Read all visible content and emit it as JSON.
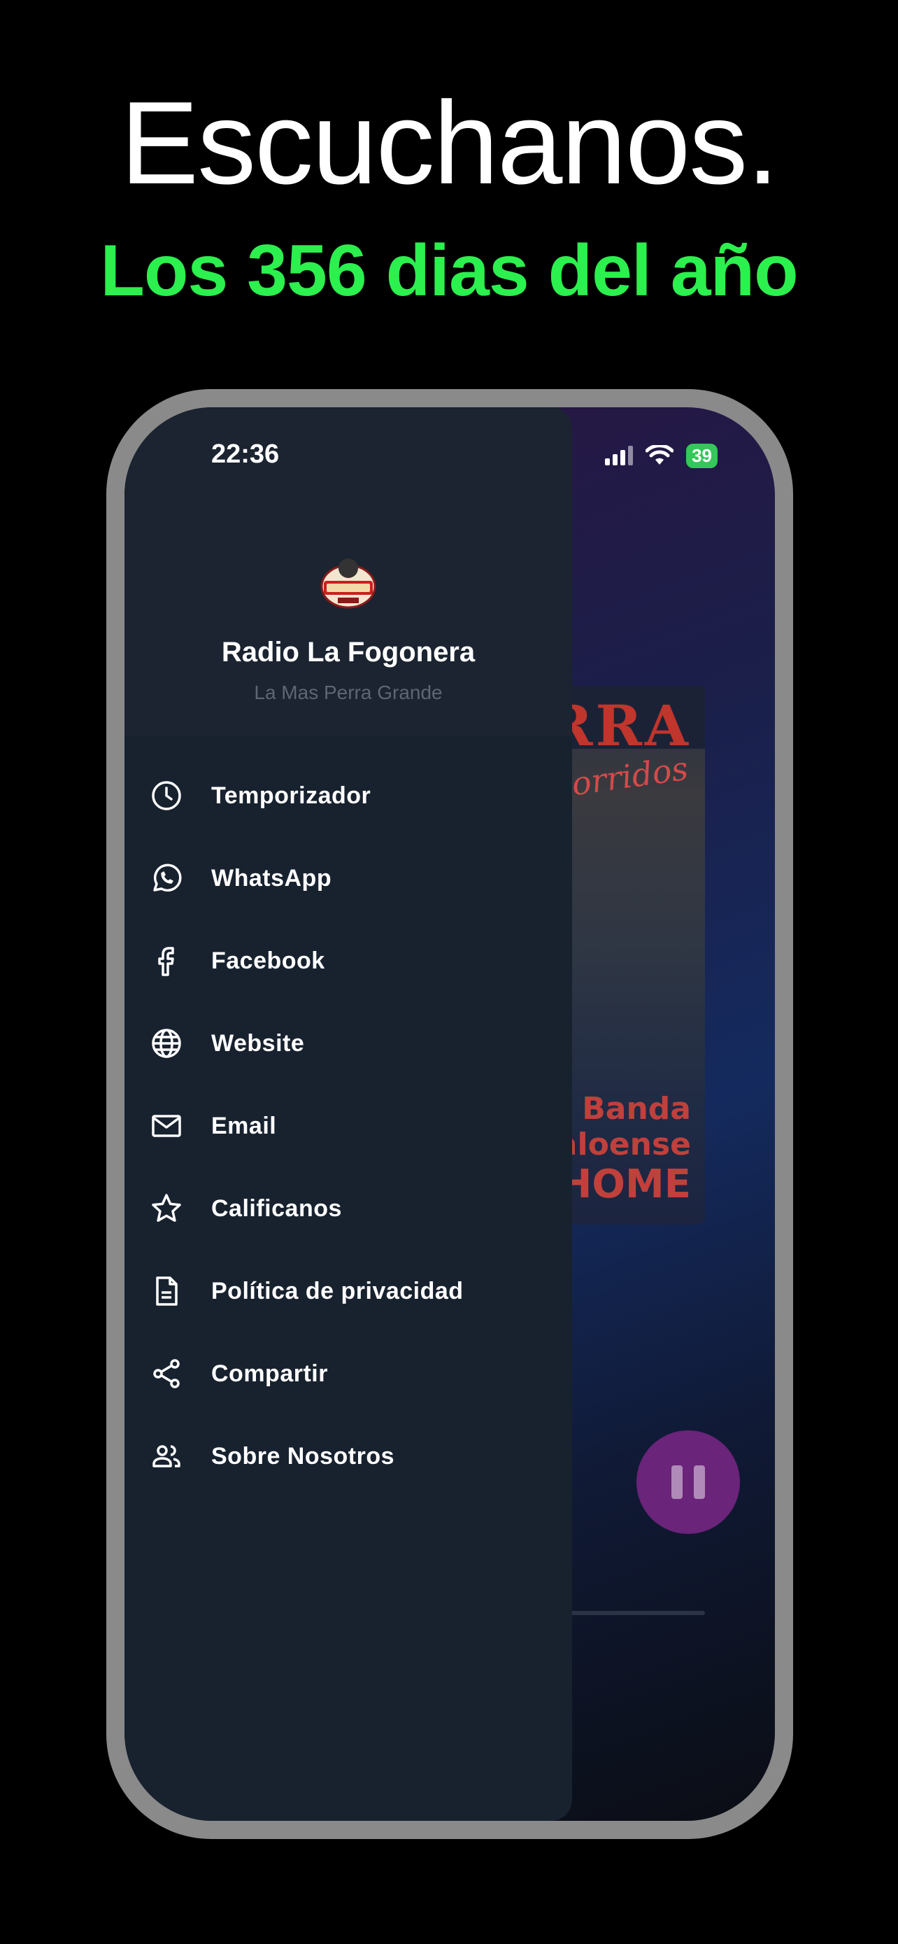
{
  "promo": {
    "headline": "Escuchanos.",
    "subline": "Los 356 dias del año"
  },
  "status_bar": {
    "time": "22:36",
    "battery": "39"
  },
  "drawer": {
    "app_name": "Radio La Fogonera",
    "tagline": "La Mas Perra Grande",
    "logo_icon": "radio-la-fogonera-logo",
    "items": [
      {
        "label": "Temporizador",
        "icon": "clock-icon"
      },
      {
        "label": "WhatsApp",
        "icon": "whatsapp-icon"
      },
      {
        "label": "Facebook",
        "icon": "facebook-icon"
      },
      {
        "label": "Website",
        "icon": "globe-icon"
      },
      {
        "label": "Email",
        "icon": "mail-icon"
      },
      {
        "label": "Calificanos",
        "icon": "star-icon"
      },
      {
        "label": "Política de privacidad",
        "icon": "document-icon"
      },
      {
        "label": "Compartir",
        "icon": "share-icon"
      },
      {
        "label": "Sobre Nosotros",
        "icon": "people-icon"
      }
    ]
  },
  "player": {
    "cover_title_fragment": "RRA",
    "cover_subtitle_fragment": "orridos",
    "cover_line1": "on Banda",
    "cover_line2": "naloense",
    "cover_line3": "HOME",
    "pause_icon": "pause-icon"
  },
  "colors": {
    "background": "#000000",
    "headline": "#ffffff",
    "subline": "#2bf04e",
    "drawer": "#18222f",
    "accent": "#6a2479"
  }
}
